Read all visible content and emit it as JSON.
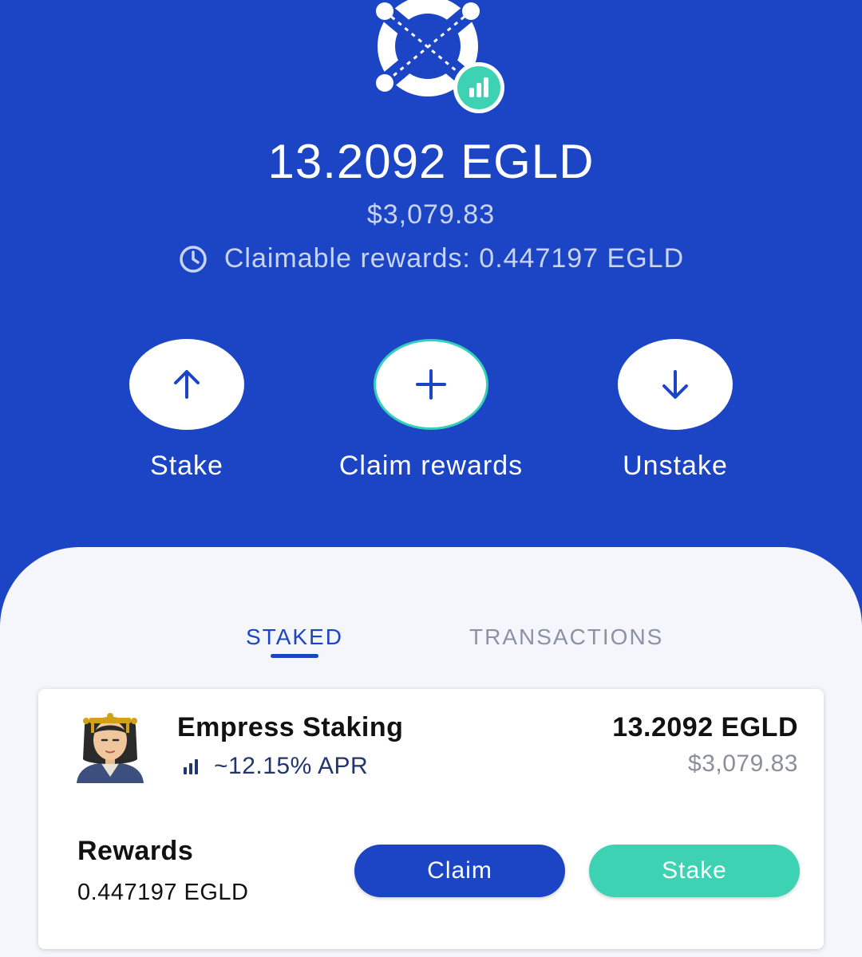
{
  "header": {
    "balance": "13.2092 EGLD",
    "fiat": "$3,079.83",
    "claimable": "Claimable rewards: 0.447197 EGLD"
  },
  "actions": [
    {
      "label": "Stake",
      "icon": "arrow-up-icon"
    },
    {
      "label": "Claim rewards",
      "icon": "plus-icon"
    },
    {
      "label": "Unstake",
      "icon": "arrow-down-icon"
    }
  ],
  "tabs": {
    "active": "STAKED",
    "inactive": "TRANSACTIONS"
  },
  "provider": {
    "name": "Empress Staking",
    "apr": "~12.15% APR",
    "staked": "13.2092 EGLD",
    "staked_fiat": "$3,079.83",
    "rewards_label": "Rewards",
    "rewards_value": "0.447197 EGLD",
    "claim_label": "Claim",
    "stake_label": "Stake"
  },
  "colors": {
    "brand_blue": "#1b45c4",
    "mint": "#3ed2b5",
    "sheet_bg": "#f4f6fb"
  }
}
